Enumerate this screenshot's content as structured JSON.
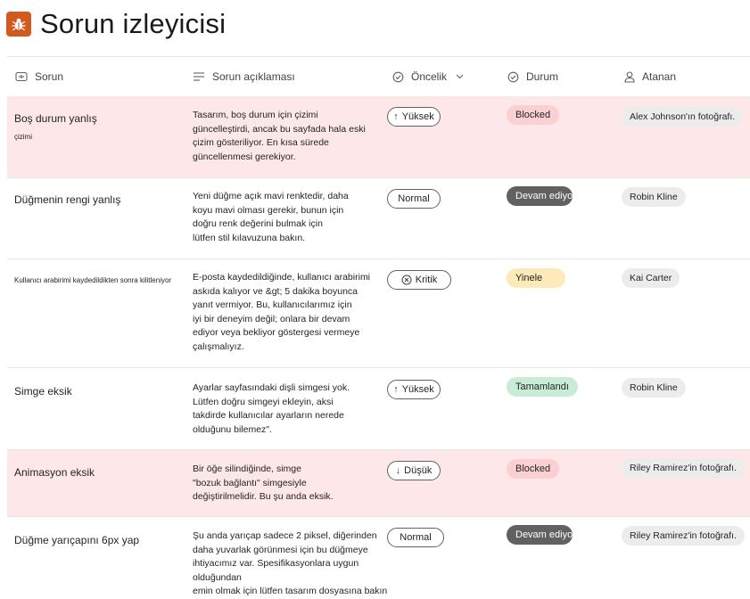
{
  "app": {
    "title": "Sorun izleyicisi",
    "icon": "bug-icon"
  },
  "columns": {
    "issue": "Sorun",
    "description": "Sorun açıklaması",
    "priority": "Öncelik",
    "status": "Durum",
    "assignee": "Atanan"
  },
  "colors": {
    "accent": "#d35a1f",
    "highlight": "#fde7e9",
    "blocked": "#fbd0d3",
    "in_progress": "#616161",
    "repeat": "#fdeab8",
    "done": "#c9ecd6"
  },
  "rows": [
    {
      "title": "Boş durum yanlış",
      "subtitle": "çizimi",
      "desc": [
        "Tasarım, boş durum için çizimi",
        "güncelleştirdi, ancak bu sayfada hala eski",
        "çizim gösteriliyor. En kısa sürede",
        "güncellenmesi gerekiyor."
      ],
      "priority": "Yüksek",
      "priority_icon": "arrow-up-icon",
      "status": "Blocked",
      "assignee": "Alex Johnson'ın fotoğrafı."
    },
    {
      "title": "Düğmenin rengi yanlış",
      "desc": [
        "Yeni düğme açık mavi renktedir, daha",
        "koyu mavi olması gerekir, bunun için",
        "doğru renk değerini bulmak için",
        "lütfen stil kılavuzuna bakın."
      ],
      "priority": "Normal",
      "status": "Devam ediyor",
      "assignee": "Robin Kline"
    },
    {
      "title": "Kullanıcı arabirimi kaydedildikten sonra kilitleniyor",
      "desc": [
        "E-posta kaydedildiğinde, kullanıcı arabirimi",
        "askıda kalıyor ve &gt; 5 dakika boyunca",
        "yanıt vermiyor. Bu, kullanıcılarımız için",
        "iyi bir deneyim değil; onlara bir devam",
        "ediyor veya bekliyor göstergesi vermeye",
        "çalışmalıyız."
      ],
      "priority": "Kritik",
      "priority_icon": "circle-x-icon",
      "status": "Yinele",
      "assignee": "Kai Carter"
    },
    {
      "title": "Simge eksik",
      "desc": [
        "Ayarlar sayfasındaki dişli simgesi yok.",
        "Lütfen doğru simgeyi ekleyin, aksi",
        "takdirde kullanıcılar ayarların nerede",
        "olduğunu bilemez\"."
      ],
      "priority": "Yüksek",
      "priority_icon": "arrow-up-icon",
      "status": "Tamamlandı",
      "assignee": "Robin Kline"
    },
    {
      "title": "Animasyon eksik",
      "desc": [
        "Bir öğe silindiğinde, simge",
        "\"bozuk bağlantı\" simgesiyle",
        "değiştirilmelidir. Bu şu anda eksik."
      ],
      "priority": "Düşük",
      "priority_icon": "arrow-down-icon",
      "status": "Blocked",
      "assignee": "Riley Ramirez'in fotoğrafı."
    },
    {
      "title": "Düğme yarıçapını 6px yap",
      "desc": [
        "Şu anda yarıçap sadece 2 piksel, diğerinden",
        "daha yuvarlak görünmesi için bu düğmeye",
        "ihtiyacımız var. Spesifikasyonlara uygun olduğundan",
        "emin olmak için lütfen tasarım dosyasına bakın"
      ],
      "priority": "Normal",
      "status": "Devam ediyor",
      "assignee": "Riley Ramirez'in fotoğrafı."
    }
  ]
}
